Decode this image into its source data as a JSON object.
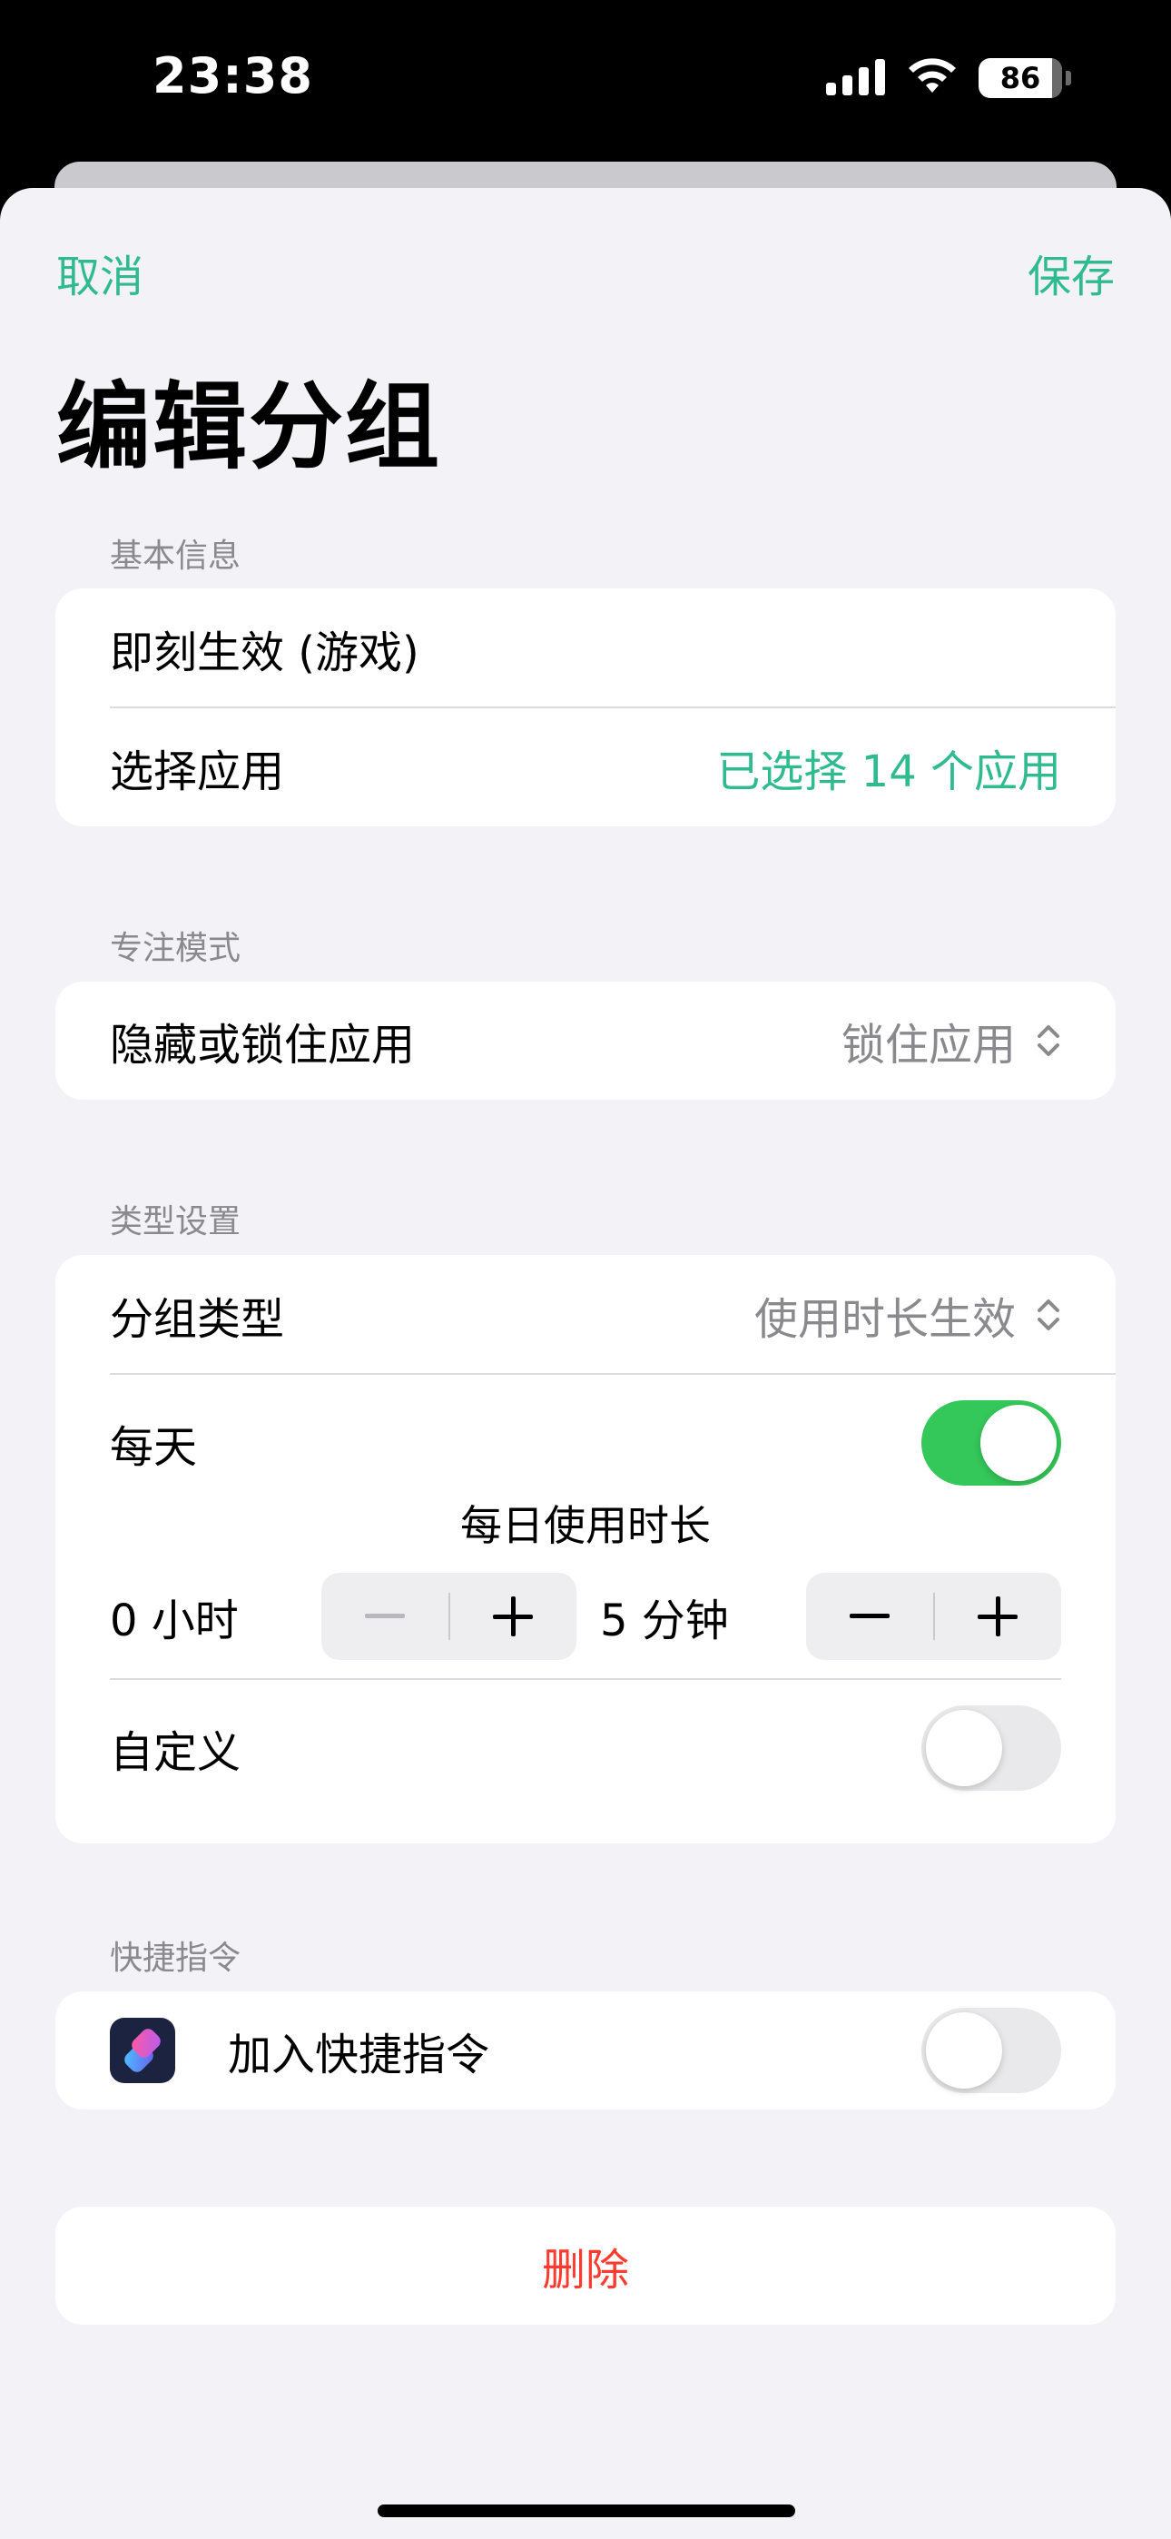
{
  "status_bar": {
    "time": "23:38",
    "battery": "86"
  },
  "nav": {
    "cancel": "取消",
    "save": "保存"
  },
  "title": "编辑分组",
  "sections": {
    "basic": {
      "header": "基本信息",
      "name_value": "即刻生效 (游戏)",
      "select_apps_label": "选择应用",
      "select_apps_value": "已选择 14 个应用"
    },
    "focus": {
      "header": "专注模式",
      "hide_lock_label": "隐藏或锁住应用",
      "hide_lock_value": "锁住应用"
    },
    "type": {
      "header": "类型设置",
      "group_type_label": "分组类型",
      "group_type_value": "使用时长生效",
      "daily_label": "每天",
      "daily_on": true,
      "daily_usage_title": "每日使用时长",
      "hours_label": "0 小时",
      "minutes_label": "5 分钟",
      "minus": "−",
      "plus": "+",
      "custom_label": "自定义",
      "custom_on": false
    },
    "shortcuts": {
      "header": "快捷指令",
      "add_label": "加入快捷指令",
      "add_on": false
    }
  },
  "delete_label": "删除",
  "colors": {
    "accent": "#2fbb8e",
    "toggle_on": "#34c759",
    "destructive": "#ff3b30",
    "background": "#f2f2f7"
  },
  "icons": [
    "cellular-signal-icon",
    "wifi-icon",
    "battery-icon",
    "chevron-up-down-icon",
    "shortcuts-app-icon"
  ]
}
